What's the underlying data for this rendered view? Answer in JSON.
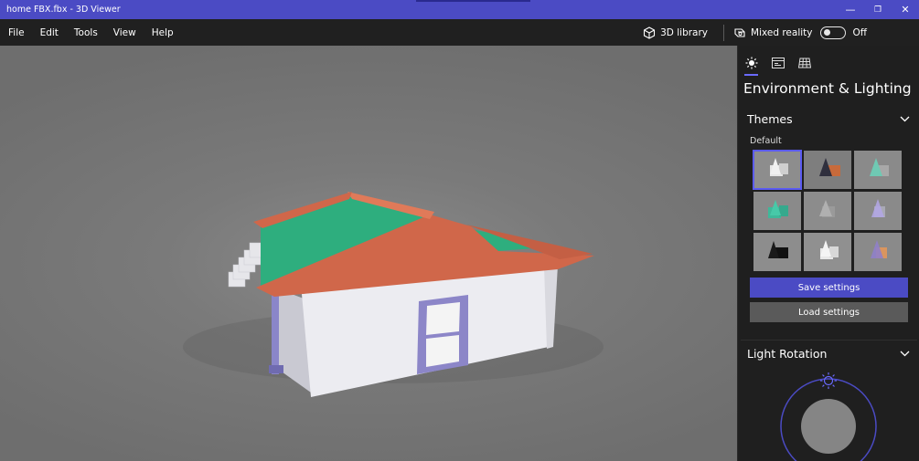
{
  "window": {
    "title": "home FBX.fbx - 3D Viewer",
    "controls": {
      "minimize": "—",
      "restore": "❐",
      "close": "✕"
    }
  },
  "menu": {
    "items": [
      {
        "label": "File"
      },
      {
        "label": "Edit"
      },
      {
        "label": "Tools"
      },
      {
        "label": "View"
      },
      {
        "label": "Help"
      }
    ],
    "library_label": "3D library",
    "mixed_reality_label": "Mixed reality",
    "mixed_reality_state": "Off"
  },
  "panel": {
    "title": "Environment & Lighting",
    "tabs": [
      "lighting",
      "stats",
      "grid"
    ],
    "themes": {
      "label": "Themes",
      "default_label": "Default",
      "items": [
        {
          "shape": "white",
          "color": "#d9d9d9",
          "selected": true
        },
        {
          "shape": "orange-dark",
          "color": "#c76a3b"
        },
        {
          "shape": "teal",
          "color": "#6fc9b3"
        },
        {
          "shape": "teal-green",
          "color": "#3fb89a"
        },
        {
          "shape": "gray",
          "color": "#9a9a9a"
        },
        {
          "shape": "lavender",
          "color": "#b3a7e6"
        },
        {
          "shape": "black",
          "color": "#111111"
        },
        {
          "shape": "white-2",
          "color": "#e8e8e8"
        },
        {
          "shape": "orange-purple",
          "color": "#b57a8f"
        }
      ]
    },
    "save_label": "Save settings",
    "load_label": "Load settings",
    "light_rotation_label": "Light Rotation"
  },
  "colors": {
    "accent": "#4b4bc4",
    "roof": "#d0674a",
    "roof_top": "#2eae7e",
    "walls": "#e8e8ee",
    "trim": "#8c86c8"
  }
}
